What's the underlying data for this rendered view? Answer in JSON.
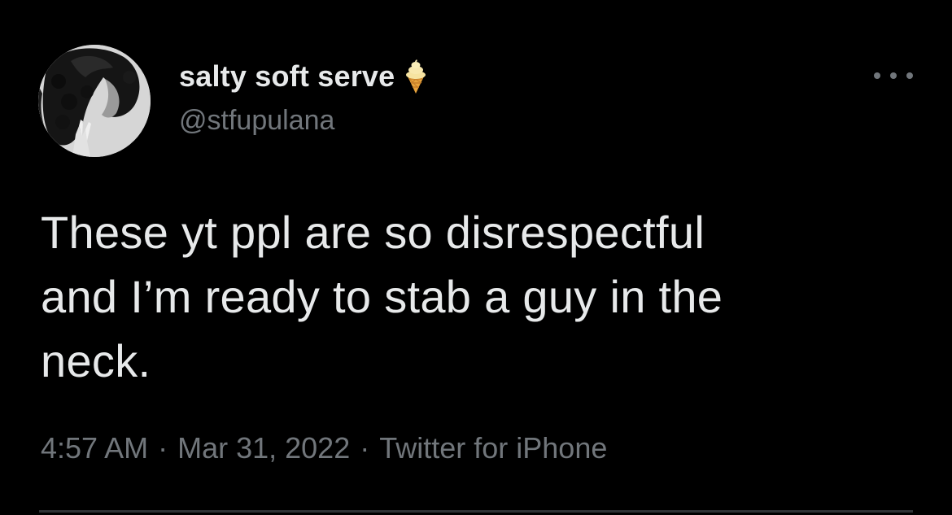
{
  "user": {
    "display_name": "salty soft serve",
    "name_emoji": "soft-serve-ice-cream-icon",
    "handle": "@stfupulana"
  },
  "tweet": {
    "text_lines": [
      "These yt ppl are so disrespectful",
      "and I’m ready to stab a guy in the",
      "neck."
    ],
    "time": "4:57 AM",
    "separator": "·",
    "date": "Mar 31, 2022",
    "source": "Twitter for iPhone"
  },
  "colors": {
    "background": "#000000",
    "primary_text": "#e7e9ea",
    "secondary_text": "#71767b",
    "divider": "#2f3336"
  }
}
